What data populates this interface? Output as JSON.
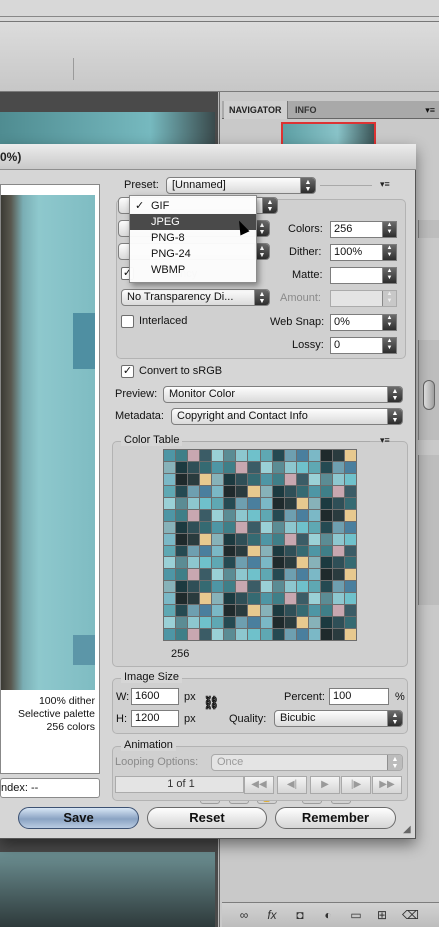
{
  "dialog": {
    "title_fragment": "0%)",
    "preview": {
      "info_lines": [
        "100% dither",
        "Selective palette",
        "256 colors"
      ],
      "index_label": "ndex: --"
    },
    "preset": {
      "label": "Preset:",
      "value": "[Unnamed]"
    },
    "format_menu": {
      "items": [
        "GIF",
        "JPEG",
        "PNG-8",
        "PNG-24",
        "WBMP"
      ],
      "checked": "GIF",
      "highlighted": "JPEG",
      "check_mark": "✓"
    },
    "settings": {
      "colors_label": "Colors:",
      "colors_value": "256",
      "dither_label": "Dither:",
      "dither_value": "100%",
      "matte_label": "Matte:",
      "matte_value": "",
      "transparency_dither": "No Transparency Di...",
      "amount_label": "Amount:",
      "amount_value": "",
      "interlaced_label": "Interlaced",
      "interlaced_checked": false,
      "websnap_label": "Web Snap:",
      "websnap_value": "0%",
      "lossy_label": "Lossy:",
      "lossy_value": "0",
      "obscured_text": "ency"
    },
    "convert_srgb": {
      "label": "Convert to sRGB",
      "checked": true
    },
    "preview_setting": {
      "label": "Preview:",
      "value": "Monitor Color"
    },
    "metadata": {
      "label": "Metadata:",
      "value": "Copyright and Contact Info"
    },
    "color_table": {
      "title": "Color Table",
      "count": "256"
    },
    "image_size": {
      "title": "Image Size",
      "w_label": "W:",
      "w_value": "1600",
      "w_unit": "px",
      "h_label": "H:",
      "h_value": "1200",
      "h_unit": "px",
      "percent_label": "Percent:",
      "percent_value": "100",
      "percent_unit": "%",
      "quality_label": "Quality:",
      "quality_value": "Bicubic"
    },
    "animation": {
      "title": "Animation",
      "looping_label": "Looping Options:",
      "looping_value": "Once",
      "frame": "1 of 1"
    },
    "buttons": {
      "save": "Save",
      "reset": "Reset",
      "remember": "Remember"
    }
  },
  "panels": {
    "navigator_tab": "NAVIGATOR",
    "info_tab": "INFO"
  },
  "icons": {
    "menu": "▾≡",
    "chain": "⛓",
    "link": "∞",
    "fx": "fx",
    "mask": "◘",
    "adjust": "◐",
    "folder": "▭",
    "new": "⊞",
    "trash": "⌫",
    "first": "◀◀",
    "prev": "◀|",
    "play": "▶",
    "next": "|▶",
    "last": "▶▶"
  },
  "colors": {
    "accent_button": "#8aa3c3",
    "menu_highlight": "#4a4a4a"
  }
}
